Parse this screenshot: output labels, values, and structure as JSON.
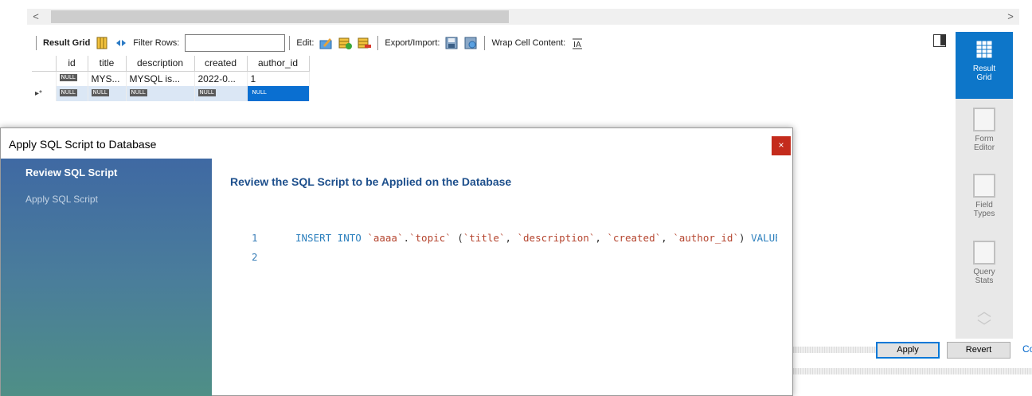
{
  "scrollbar": {
    "left_arrow": "<",
    "right_arrow": ">"
  },
  "toolbar": {
    "result_grid": "Result Grid",
    "filter_rows": "Filter Rows:",
    "filter_value": "",
    "edit": "Edit:",
    "export_import": "Export/Import:",
    "wrap_cell": "Wrap Cell Content:"
  },
  "grid": {
    "columns": [
      "id",
      "title",
      "description",
      "created",
      "author_id"
    ],
    "row1": {
      "id": "NULL",
      "title": "MYS...",
      "description": "MYSQL is...",
      "created": "2022-0...",
      "author_id": "1"
    },
    "new_row": {
      "marker": "▸*",
      "id": "NULL",
      "title": "NULL",
      "description": "NULL",
      "created": "NULL",
      "author_id": "NULL"
    }
  },
  "sidepanel": {
    "result_grid": "Result Grid",
    "form_editor": "Form Editor",
    "field_types": "Field Types",
    "query_stats": "Query Stats"
  },
  "buttons": {
    "apply": "Apply",
    "revert": "Revert",
    "cut_text": "Co"
  },
  "dialog": {
    "title": "Apply SQL Script to Database",
    "close": "×",
    "steps": [
      "Review SQL Script",
      "Apply SQL Script"
    ],
    "heading": "Review the SQL Script to be Applied on the Database",
    "lines": [
      {
        "num": "1",
        "parts": [
          {
            "t": "INSERT INTO ",
            "c": "kw"
          },
          {
            "t": "`aaaa`",
            "c": "str"
          },
          {
            "t": ".",
            "c": "pl"
          },
          {
            "t": "`topic`",
            "c": "str"
          },
          {
            "t": " (",
            "c": "pl"
          },
          {
            "t": "`title`",
            "c": "str"
          },
          {
            "t": ", ",
            "c": "pl"
          },
          {
            "t": "`description`",
            "c": "str"
          },
          {
            "t": ", ",
            "c": "pl"
          },
          {
            "t": "`created`",
            "c": "str"
          },
          {
            "t": ", ",
            "c": "pl"
          },
          {
            "t": "`author_id`",
            "c": "str"
          },
          {
            "t": ") ",
            "c": "pl"
          },
          {
            "t": "VALUES",
            "c": "kw"
          }
        ]
      },
      {
        "num": "2",
        "parts": []
      }
    ]
  },
  "colors": {
    "accent": "#0d76c9",
    "selected_cell": "#0a6fd1",
    "close_red": "#c42b1c",
    "heading_blue": "#1d4f8c"
  }
}
